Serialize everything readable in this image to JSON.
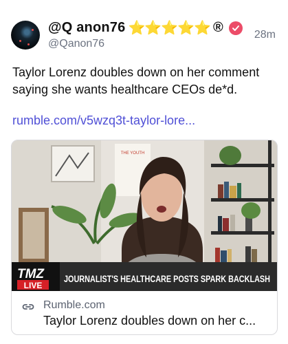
{
  "post": {
    "display_name": "@Q anon76",
    "stars": "⭐⭐⭐⭐⭐",
    "registered_mark": "®",
    "handle": "@Qanon76",
    "timestamp": "28m",
    "text": "Taylor Lorenz doubles down on her comment saying she wants healthcare CEOs de*d.",
    "link_text": "rumble.com/v5wzq3t-taylor-lore..."
  },
  "card": {
    "tmz_logo": "TMZ",
    "tmz_live": "LIVE",
    "banner_text": "JOURNALIST'S HEALTHCARE POSTS SPARK BACKLASH",
    "wall_text": "THE YOUTH",
    "domain": "Rumble.com",
    "title": "Taylor Lorenz doubles down on her c..."
  },
  "colors": {
    "star": "#f2c12e",
    "verified": "#ec4c68",
    "link": "#4f4fd6",
    "muted": "#6b7280",
    "banner_bg": "#2b2b2b",
    "tmz_red": "#d62027"
  },
  "icons": {
    "verified": "verified-badge-icon",
    "link": "link-chain-icon"
  }
}
